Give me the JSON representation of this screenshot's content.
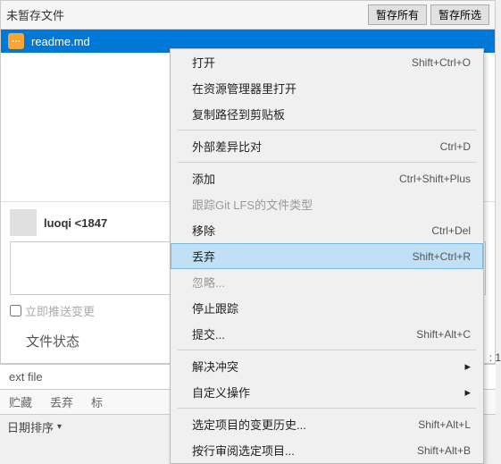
{
  "header": {
    "title": "未暂存文件",
    "stage_all": "暂存所有",
    "stage_selected": "暂存所选"
  },
  "file": {
    "name": "readme.md",
    "icon": "⋯"
  },
  "commit": {
    "user": "luoqi <1847",
    "checkbox_label": "立即推送变更",
    "status": "文件状态"
  },
  "bottom": {
    "label": "ext file",
    "right_num": ": 1"
  },
  "tabs": {
    "t1": "贮藏",
    "t2": "丢弃",
    "t3": "标"
  },
  "sort": {
    "label": "日期排序"
  },
  "menu": {
    "open": "打开",
    "open_sc": "Shift+Ctrl+O",
    "open_explorer": "在资源管理器里打开",
    "copy_path": "复制路径到剪贴板",
    "external_diff": "外部差异比对",
    "external_diff_sc": "Ctrl+D",
    "add": "添加",
    "add_sc": "Ctrl+Shift+Plus",
    "track_lfs": "跟踪Git LFS的文件类型",
    "remove": "移除",
    "remove_sc": "Ctrl+Del",
    "discard": "丢弃",
    "discard_sc": "Shift+Ctrl+R",
    "ignore": "忽略...",
    "stop_track": "停止跟踪",
    "commit": "提交...",
    "commit_sc": "Shift+Alt+C",
    "resolve": "解决冲突",
    "custom": "自定义操作",
    "log_selected": "选定项目的变更历史...",
    "log_selected_sc": "Shift+Alt+L",
    "blame": "按行审阅选定项目...",
    "blame_sc": "Shift+Alt+B"
  }
}
